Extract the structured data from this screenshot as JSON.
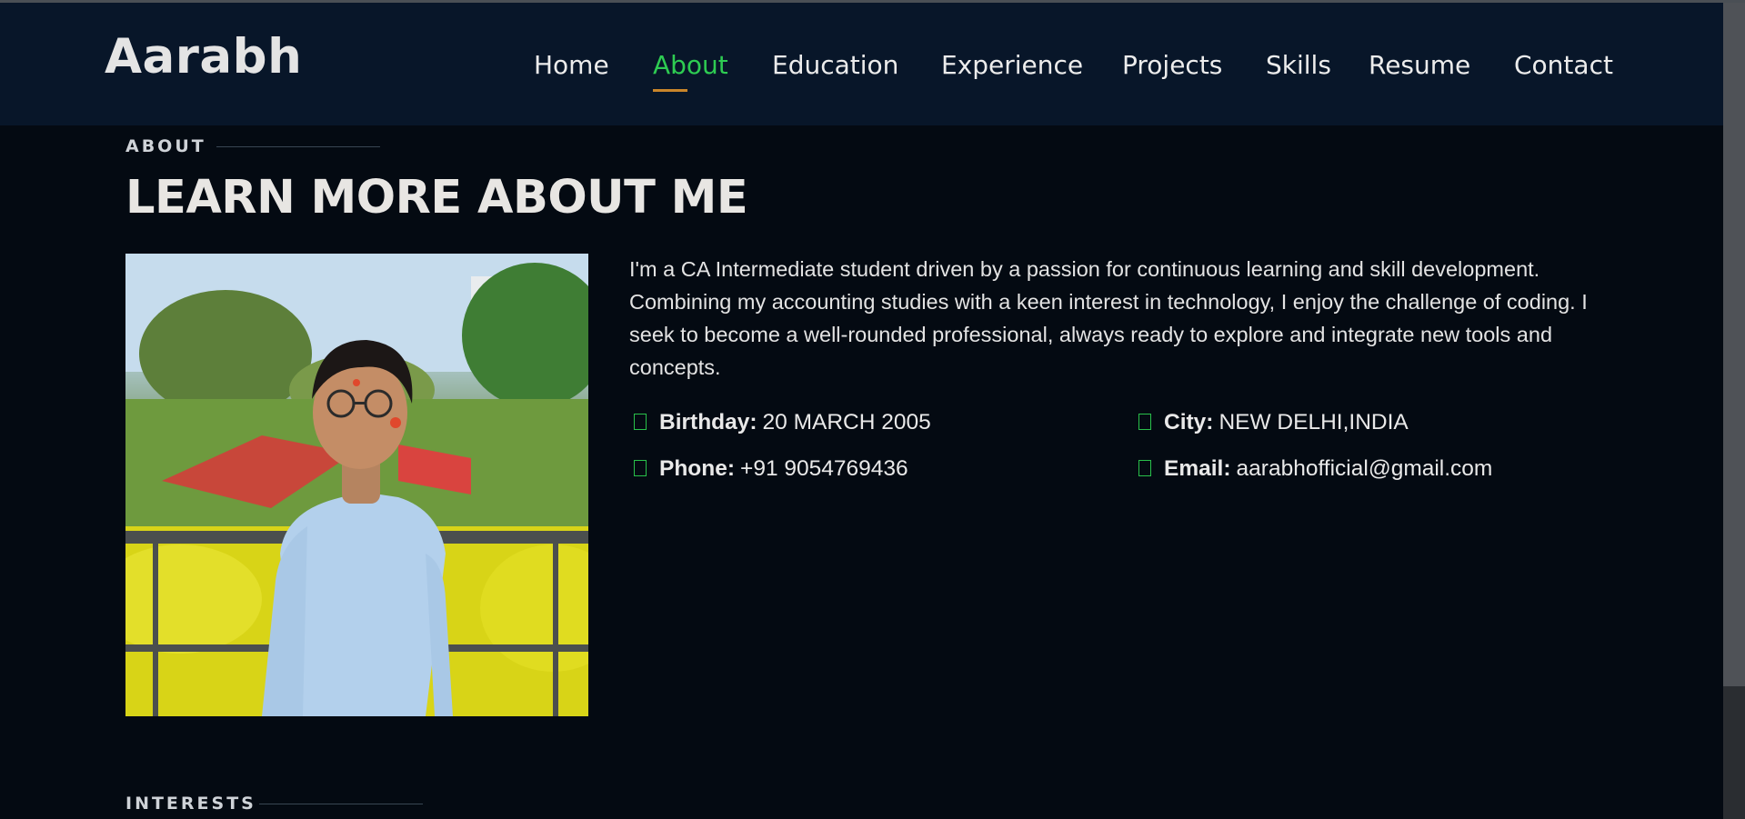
{
  "header": {
    "brand": "Aarabh",
    "nav": [
      {
        "label": "Home",
        "active": false
      },
      {
        "label": "About",
        "active": true
      },
      {
        "label": "Education",
        "active": false
      },
      {
        "label": "Experience",
        "active": false
      },
      {
        "label": "Projects",
        "active": false
      },
      {
        "label": "Skills",
        "active": false
      },
      {
        "label": "Resume",
        "active": false
      },
      {
        "label": "Contact",
        "active": false
      }
    ]
  },
  "about": {
    "tag": "ABOUT",
    "headline": "LEARN MORE ABOUT ME",
    "bio": "I'm a CA Intermediate student driven by a passion for continuous learning and skill development. Combining my accounting studies with a keen interest in technology, I enjoy the challenge of coding. I seek to become a well-rounded professional, always ready to explore and integrate new tools and concepts.",
    "details": {
      "birthday": {
        "label": "Birthday:",
        "value": "20 MARCH 2005"
      },
      "city": {
        "label": "City:",
        "value": "NEW DELHI,INDIA"
      },
      "phone": {
        "label": "Phone:",
        "value": "+91 9054769436"
      },
      "email": {
        "label": "Email:",
        "value": "aarabhofficial@gmail.com"
      }
    }
  },
  "interests": {
    "tag": "INTERESTS"
  },
  "colors": {
    "active_nav": "#2ecc52",
    "nav_underline": "#c9852a",
    "header_bg": "#081629",
    "page_bg": "#040a12",
    "bullet_icon": "#29c04a"
  }
}
